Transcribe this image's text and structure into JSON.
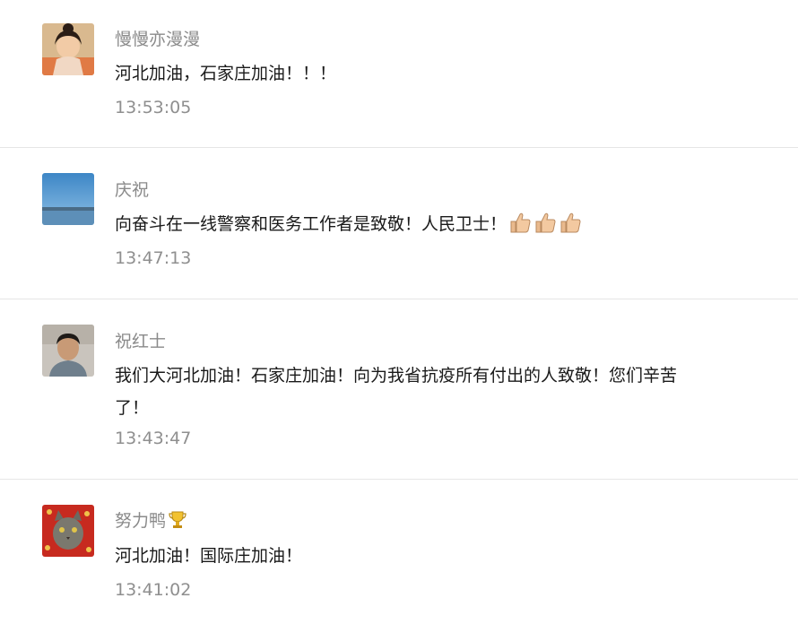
{
  "comments": [
    {
      "nickname": "慢慢亦漫漫",
      "text": "河北加油，石家庄加油！！！",
      "time": "13:53:05",
      "avatar_icon": "girl-avatar"
    },
    {
      "nickname": "庆祝",
      "text": "向奋斗在一线警察和医务工作者是致敬！人民卫士！",
      "emoji_icons": [
        "thumbs-up-icon",
        "thumbs-up-icon",
        "thumbs-up-icon"
      ],
      "time": "13:47:13",
      "avatar_icon": "sky-lake-avatar"
    },
    {
      "nickname": "祝红士",
      "text": "我们大河北加油！石家庄加油！向为我省抗疫所有付出的人致敬！您们辛苦了！",
      "time": "13:43:47",
      "avatar_icon": "boy-avatar"
    },
    {
      "nickname": "努力鸭",
      "badge_icon": "trophy-icon",
      "text": "河北加油！国际庄加油！",
      "time": "13:41:02",
      "avatar_icon": "cat-avatar"
    }
  ],
  "colors": {
    "nickname": "#8a8a8a",
    "text": "#1a1a1a",
    "timestamp": "#8f8f8f",
    "divider": "#e6e6e6"
  }
}
